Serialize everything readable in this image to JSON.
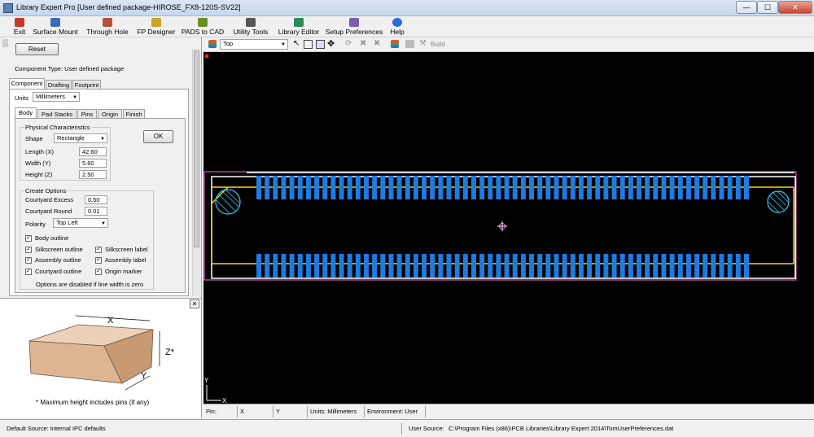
{
  "window": {
    "title": "Library Expert Pro [User defined package-HIROSE_FX8-120S-SV22]",
    "minimize": "—",
    "maximize": "☐",
    "close": "✕"
  },
  "menu": {
    "items": [
      {
        "label": "Exit",
        "color": "#c0392b"
      },
      {
        "label": "Surface Mount",
        "color": "#3b6db5"
      },
      {
        "label": "Through Hole",
        "color": "#b5513b"
      },
      {
        "label": "FP Designer",
        "color": "#c9a227"
      },
      {
        "label": "PADS to CAD",
        "color": "#6b8e23"
      },
      {
        "label": "Utility Tools",
        "color": "#555555"
      },
      {
        "label": "Library Editor",
        "color": "#2e8b57"
      },
      {
        "label": "Setup Preferences",
        "color": "#7a5cb0"
      },
      {
        "label": "Help",
        "color": "#2a6fd6"
      }
    ]
  },
  "left": {
    "reset_label": "Reset",
    "component_type": "Component Type: User defined package",
    "tabs": [
      "Component",
      "Drafting",
      "Footprint"
    ],
    "units_label": "Units",
    "units_value": "Millimeters",
    "subtabs": [
      "Body",
      "Pad Stacks",
      "Pins",
      "Origin",
      "Finish"
    ],
    "physical": {
      "title": "Physical Characteristics",
      "shape_label": "Shape",
      "shape_value": "Rectangle",
      "length_label": "Length (X)",
      "length_value": "42.60",
      "width_label": "Width (Y)",
      "width_value": "5.60",
      "height_label": "Height (Z)",
      "height_value": "2.50",
      "ok_label": "OK"
    },
    "create": {
      "title": "Create Options",
      "excess_label": "Courtyard Excess",
      "excess_value": "0.50",
      "round_label": "Courtyard Round",
      "round_value": "0.01",
      "polarity_label": "Polarity",
      "polarity_value": "Top Left",
      "checks": [
        {
          "label": "Body outline",
          "checked": "✓"
        },
        {
          "label": "Silkscreen outline",
          "checked": "✓"
        },
        {
          "label": "Silkscreen label",
          "checked": "✓"
        },
        {
          "label": "Assembly outline",
          "checked": "✓"
        },
        {
          "label": "Assembly label",
          "checked": "✓"
        },
        {
          "label": "Courtyard outline",
          "checked": "✓"
        },
        {
          "label": "Origin marker",
          "checked": "✓"
        }
      ],
      "note": "Options are disabled if line width is zero"
    }
  },
  "diagram": {
    "x_label": "X",
    "y_label": "Y",
    "z_label": "Z*",
    "footnote": "*  Maximum height includes pins (if any)"
  },
  "canvas_toolbar": {
    "layer_value": "Top",
    "build_label": "Build"
  },
  "canvas": {
    "pads_per_row": 60,
    "pad_color": "#1e7be0",
    "silk_color": "#ffd21f",
    "courtyard_color": "#ff6ad5",
    "axis_y": "Y",
    "axis_x": "X"
  },
  "canvas_status": {
    "pin": "Pin:",
    "x": "X",
    "y": "Y",
    "units": "Units: Millimeters",
    "environment": "Environment: User"
  },
  "status": {
    "default_source": "Default Source:  Internal IPC defaults",
    "user_source_label": "User Source:",
    "user_source_path": "C:\\Program Files (x86)\\PCB Libraries\\Library Expert 2014\\TomUserPreferences.dat"
  }
}
